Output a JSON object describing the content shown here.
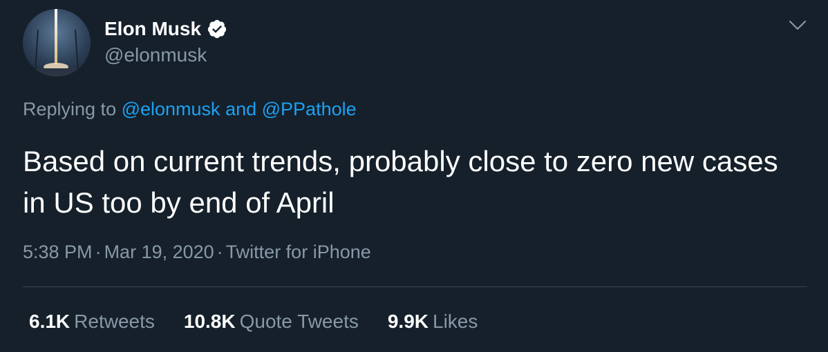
{
  "author": {
    "display_name": "Elon Musk",
    "handle": "@elonmusk",
    "verified": true,
    "verified_icon": "verified-badge-icon"
  },
  "reply": {
    "prefix": "Replying to ",
    "mention_1": "@elonmusk",
    "conjunction": " and ",
    "mention_2": "@PPathole"
  },
  "tweet": {
    "text": "Based on current trends, probably close to zero new cases in US too by end of April"
  },
  "meta": {
    "time": "5:38 PM",
    "separator": "·",
    "date": "Mar 19, 2020",
    "source": "Twitter for iPhone"
  },
  "stats": {
    "retweets_count": "6.1K",
    "retweets_label": "Retweets",
    "quotes_count": "10.8K",
    "quotes_label": "Quote Tweets",
    "likes_count": "9.9K",
    "likes_label": "Likes"
  },
  "colors": {
    "background": "#15202b",
    "text": "#ffffff",
    "secondary": "#8899a6",
    "link": "#1da1f2",
    "divider": "#38444d"
  },
  "icons": {
    "menu": "chevron-down-icon",
    "verified": "verified-badge-icon"
  }
}
